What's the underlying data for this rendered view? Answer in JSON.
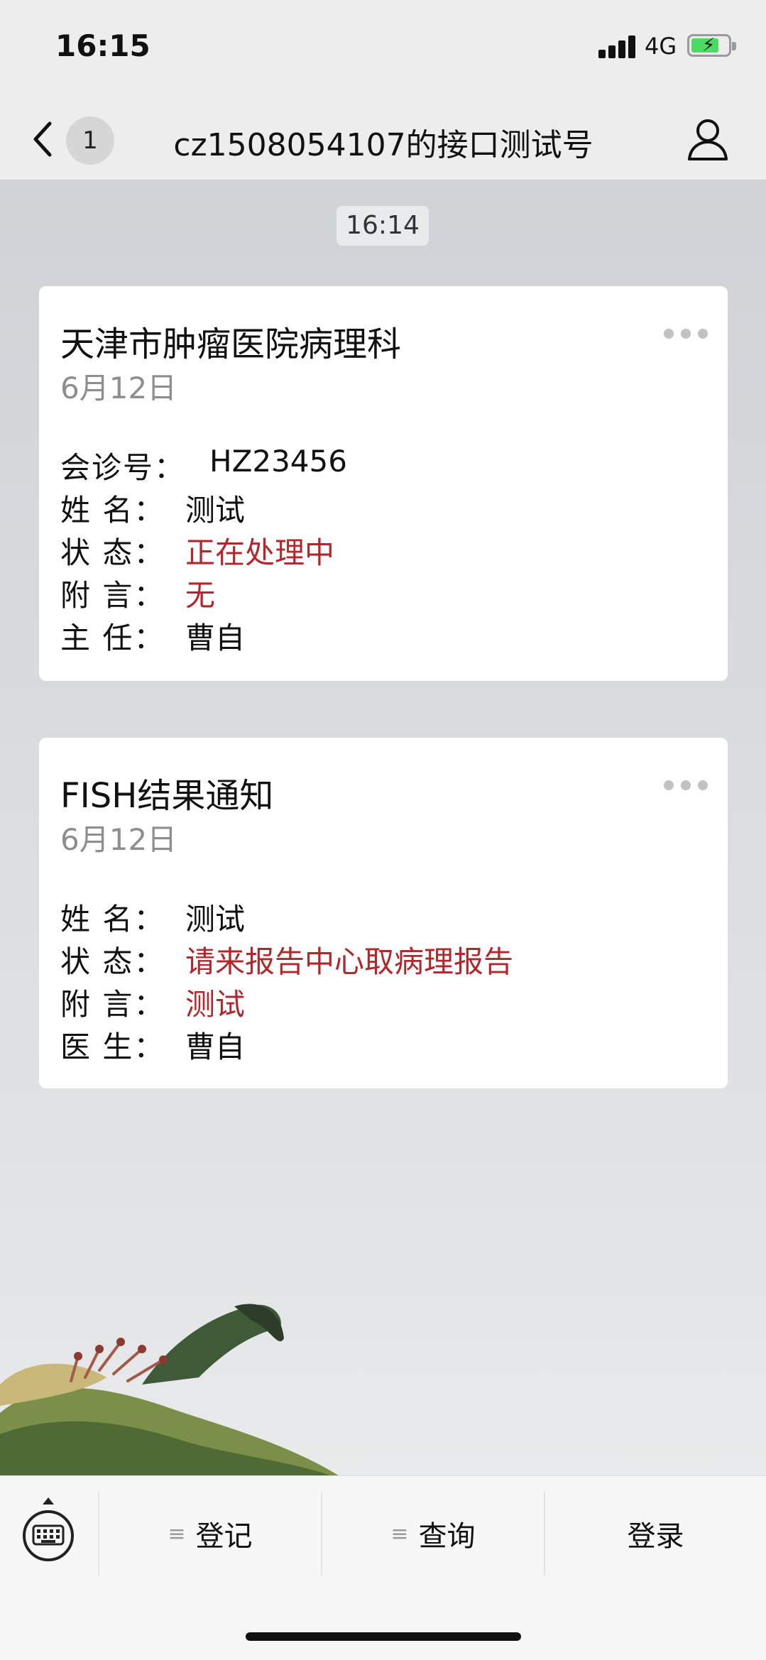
{
  "status_bar": {
    "time": "16:15",
    "network": "4G",
    "battery_color": "#4cd964"
  },
  "nav": {
    "back_icon": "chevron-left-icon",
    "unread_count": "1",
    "title": "cz1508054107的接口测试号",
    "profile_icon": "person-icon"
  },
  "chat": {
    "timestamp": "16:14",
    "messages": [
      {
        "title": "天津市肿瘤医院病理科",
        "date": "6月12日",
        "fields": [
          {
            "label": "会诊号：",
            "value": "HZ23456",
            "highlight": false
          },
          {
            "label": "姓 名：",
            "value": "测试",
            "highlight": false
          },
          {
            "label": "状 态：",
            "value": "正在处理中",
            "highlight": true
          },
          {
            "label": "附 言：",
            "value": "无",
            "highlight": true
          },
          {
            "label": "主 任：",
            "value": "曹自",
            "highlight": false
          }
        ]
      },
      {
        "title": "FISH结果通知",
        "date": "6月12日",
        "fields": [
          {
            "label": "姓 名：",
            "value": "测试",
            "highlight": false
          },
          {
            "label": "状 态：",
            "value": "请来报告中心取病理报告",
            "highlight": true
          },
          {
            "label": "附 言：",
            "value": "测试",
            "highlight": true
          },
          {
            "label": "医 生：",
            "value": "曹自",
            "highlight": false
          }
        ]
      }
    ]
  },
  "menu": {
    "keyboard_icon": "keyboard-icon",
    "items": [
      {
        "label": "登记",
        "icon": "list-icon"
      },
      {
        "label": "查询",
        "icon": "list-icon"
      },
      {
        "label": "登录"
      }
    ]
  },
  "colors": {
    "highlight_red": "#b2272b",
    "secondary_gray": "#8e8e8e"
  }
}
